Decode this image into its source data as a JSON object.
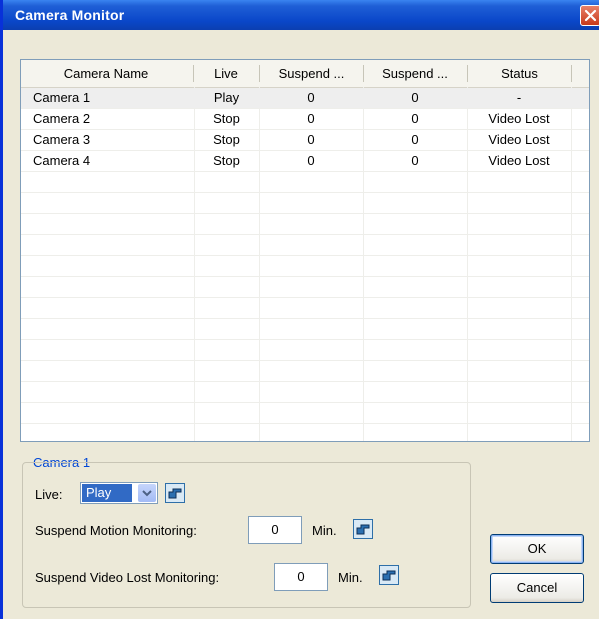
{
  "window": {
    "title": "Camera Monitor"
  },
  "table": {
    "headers": [
      "Camera Name",
      "Live",
      "Suspend ...",
      "Suspend ...",
      "Status"
    ],
    "rows": [
      [
        "Camera 1",
        "Play",
        "0",
        "0",
        "-"
      ],
      [
        "Camera 2",
        "Stop",
        "0",
        "0",
        "Video Lost"
      ],
      [
        "Camera 3",
        "Stop",
        "0",
        "0",
        "Video Lost"
      ],
      [
        "Camera 4",
        "Stop",
        "0",
        "0",
        "Video Lost"
      ]
    ],
    "selected_row": 0
  },
  "group": {
    "title": "Camera 1",
    "live_label": "Live:",
    "live_value": "Play",
    "motion_label": "Suspend Motion Monitoring:",
    "motion_value": "0",
    "motion_unit": "Min.",
    "video_lost_label": "Suspend Video Lost Monitoring:",
    "video_lost_value": "0",
    "video_lost_unit": "Min."
  },
  "buttons": {
    "ok": "OK",
    "cancel": "Cancel"
  },
  "icons": {
    "close": "close-icon",
    "apply": "pointing-hand-icon",
    "dropdown": "chevron-down-icon"
  },
  "colors": {
    "titlebar": "#0a47c9",
    "selection": "#316ac5",
    "group_title": "#0046d5"
  }
}
